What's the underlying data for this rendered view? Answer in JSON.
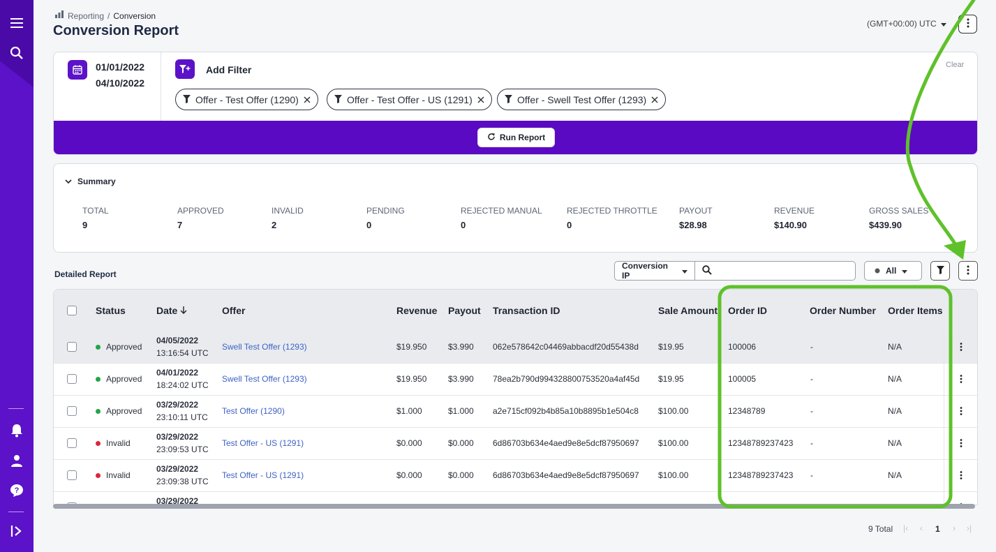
{
  "breadcrumb": {
    "root": "Reporting",
    "sep": "/",
    "current": "Conversion"
  },
  "page_title": "Conversion Report",
  "timezone": "(GMT+00:00) UTC",
  "filters": {
    "date_from": "01/01/2022",
    "date_to": "04/10/2022",
    "add_filter_label": "Add Filter",
    "clear_label": "Clear",
    "chips": [
      "Offer - Test Offer (1290)",
      "Offer - Test Offer - US (1291)",
      "Offer - Swell Test Offer (1293)"
    ],
    "run_report_label": "Run Report"
  },
  "summary": {
    "title": "Summary",
    "metrics": [
      {
        "label": "TOTAL",
        "value": "9"
      },
      {
        "label": "APPROVED",
        "value": "7"
      },
      {
        "label": "INVALID",
        "value": "2"
      },
      {
        "label": "PENDING",
        "value": "0"
      },
      {
        "label": "REJECTED MANUAL",
        "value": "0"
      },
      {
        "label": "REJECTED THROTTLE",
        "value": "0"
      },
      {
        "label": "PAYOUT",
        "value": "$28.98"
      },
      {
        "label": "REVENUE",
        "value": "$140.90"
      },
      {
        "label": "GROSS SALES",
        "value": "$439.90"
      }
    ]
  },
  "detailed": {
    "title": "Detailed Report",
    "search_field": "Conversion IP",
    "search_placeholder": "",
    "status_filter": "All"
  },
  "table": {
    "columns": {
      "status": "Status",
      "date": "Date",
      "offer": "Offer",
      "revenue": "Revenue",
      "payout": "Payout",
      "transaction_id": "Transaction ID",
      "sale_amount": "Sale Amount",
      "order_id": "Order ID",
      "order_number": "Order Number",
      "order_items": "Order Items"
    },
    "rows": [
      {
        "status": "Approved",
        "status_color": "#22a447",
        "date": "04/05/2022",
        "time": "13:16:54 UTC",
        "offer": "Swell Test Offer (1293)",
        "revenue": "$19.950",
        "payout": "$3.990",
        "transaction_id": "062e578642c04469abbacdf20d55438d",
        "sale_amount": "$19.95",
        "order_id": "100006",
        "order_number": "-",
        "order_items": "N/A"
      },
      {
        "status": "Approved",
        "status_color": "#22a447",
        "date": "04/01/2022",
        "time": "18:24:02 UTC",
        "offer": "Swell Test Offer (1293)",
        "revenue": "$19.950",
        "payout": "$3.990",
        "transaction_id": "78ea2b790d994328800753520a4af45d",
        "sale_amount": "$19.95",
        "order_id": "100005",
        "order_number": "-",
        "order_items": "N/A"
      },
      {
        "status": "Approved",
        "status_color": "#22a447",
        "date": "03/29/2022",
        "time": "23:10:11 UTC",
        "offer": "Test Offer (1290)",
        "revenue": "$1.000",
        "payout": "$1.000",
        "transaction_id": "a2e715cf092b4b85a10b8895b1e504c8",
        "sale_amount": "$100.00",
        "order_id": "12348789",
        "order_number": "-",
        "order_items": "N/A"
      },
      {
        "status": "Invalid",
        "status_color": "#e0243a",
        "date": "03/29/2022",
        "time": "23:09:53 UTC",
        "offer": "Test Offer - US (1291)",
        "revenue": "$0.000",
        "payout": "$0.000",
        "transaction_id": "6d86703b634e4aed9e8e5dcf87950697",
        "sale_amount": "$100.00",
        "order_id": "12348789237423",
        "order_number": "-",
        "order_items": "N/A"
      },
      {
        "status": "Invalid",
        "status_color": "#e0243a",
        "date": "03/29/2022",
        "time": "23:09:38 UTC",
        "offer": "Test Offer - US (1291)",
        "revenue": "$0.000",
        "payout": "$0.000",
        "transaction_id": "6d86703b634e4aed9e8e5dcf87950697",
        "sale_amount": "$100.00",
        "order_id": "12348789237423",
        "order_number": "-",
        "order_items": "N/A"
      },
      {
        "status": "",
        "status_color": "#22a447",
        "date": "03/29/2022",
        "time": "",
        "offer": "",
        "revenue": "",
        "payout": "",
        "transaction_id": "",
        "sale_amount": "",
        "order_id": "",
        "order_number": "",
        "order_items": ""
      }
    ]
  },
  "pagination": {
    "total": "9 Total",
    "page": "1"
  },
  "colors": {
    "brand": "#5b0ac4",
    "sidebar": "#5b12c8",
    "annotation": "#5fc12a",
    "link": "#3e63c4"
  },
  "icons": [
    "menu-icon",
    "search-icon",
    "bell-icon",
    "user-icon",
    "help-icon",
    "expand-sidebar-icon",
    "calendar-icon",
    "filter-plus-icon",
    "filter-icon",
    "close-icon",
    "refresh-icon",
    "chevron-down-icon",
    "sort-down-icon",
    "kebab-icon"
  ]
}
